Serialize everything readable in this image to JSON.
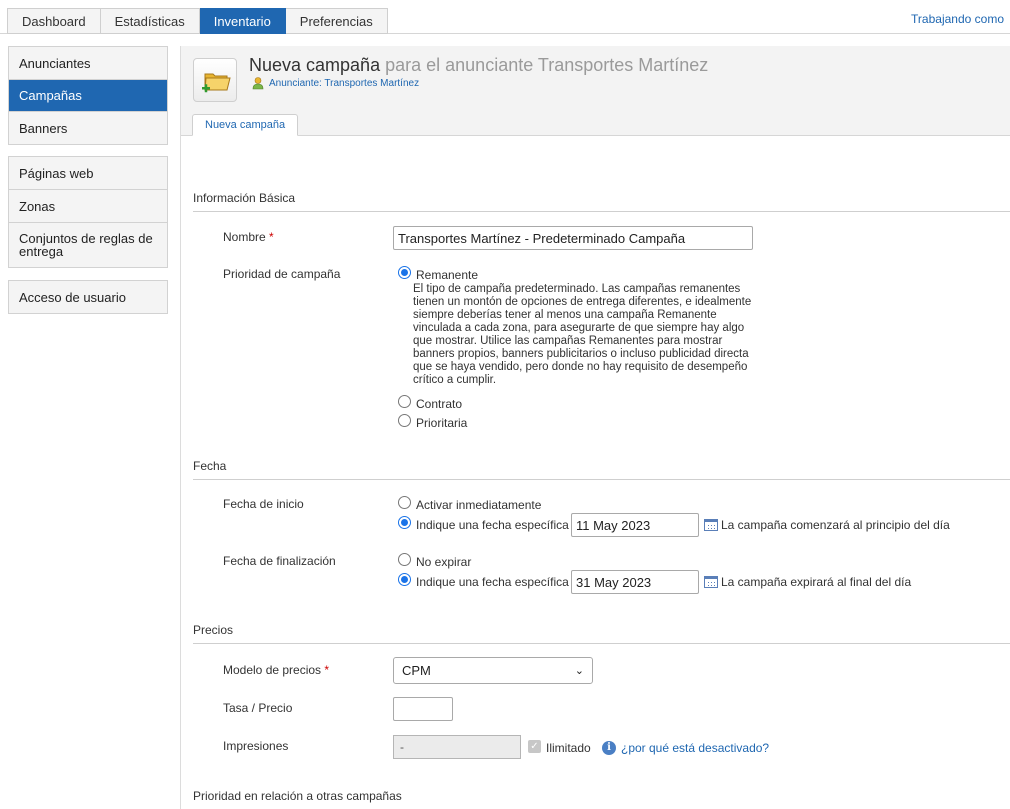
{
  "topnav": {
    "tabs": [
      {
        "label": "Dashboard"
      },
      {
        "label": "Estadísticas"
      },
      {
        "label": "Inventario"
      },
      {
        "label": "Preferencias"
      }
    ],
    "active": "Inventario",
    "working_as": "Trabajando como"
  },
  "sidebar": {
    "group1": [
      "Anunciantes",
      "Campañas",
      "Banners"
    ],
    "group2": [
      "Páginas web",
      "Zonas",
      "Conjuntos de reglas de entrega"
    ],
    "group3": [
      "Acceso de usuario"
    ],
    "active": "Campañas"
  },
  "header": {
    "title": "Nueva campaña",
    "title_suffix": "para el anunciante Transportes Martínez",
    "advertiser_link": "Anunciante: Transportes Martínez",
    "tab": "Nueva campaña"
  },
  "basic": {
    "section": "Información Básica",
    "name_label": "Nombre",
    "required_mark": "*",
    "name_value": "Transportes Martínez - Predeterminado Campaña",
    "priority_label": "Prioridad de campaña",
    "opt_remnant": "Remanente",
    "remnant_desc": "El tipo de campaña predeterminado. Las campañas remanentes tienen un montón de opciones de entrega diferentes, e idealmente siempre deberías tener al menos una campaña Remanente vinculada a cada zona, para asegurarte de que siempre hay algo que mostrar. Utilice las campañas Remanentes para mostrar banners propios, banners publicitarios o incluso publicidad directa que se haya vendido, pero donde no hay requisito de desempeño crítico a cumplir.",
    "opt_contract": "Contrato",
    "opt_priority": "Prioritaria",
    "selected": "Remanente"
  },
  "date": {
    "section": "Fecha",
    "start_label": "Fecha de inicio",
    "start_opt_now": "Activar inmediatamente",
    "start_opt_specific": "Indique una fecha específica",
    "start_value": "11 May 2023",
    "start_note": "La campaña comenzará al principio del día",
    "end_label": "Fecha de finalización",
    "end_opt_never": "No expirar",
    "end_opt_specific": "Indique una fecha específica",
    "end_value": "31 May 2023",
    "end_note": "La campaña expirará al final del día"
  },
  "pricing": {
    "section": "Precios",
    "model_label": "Modelo de precios",
    "model_value": "CPM",
    "rate_label": "Tasa / Precio",
    "rate_value": "",
    "impressions_label": "Impresiones",
    "impressions_value": "-",
    "unlimited_label": "Ilimitado",
    "unlimited_checked": true,
    "why_disabled": "¿por qué está desactivado?"
  },
  "relative_priority": {
    "section": "Prioridad en relación a otras campañas"
  },
  "colors": {
    "accent": "#1f67b1",
    "required": "#cc0000"
  }
}
